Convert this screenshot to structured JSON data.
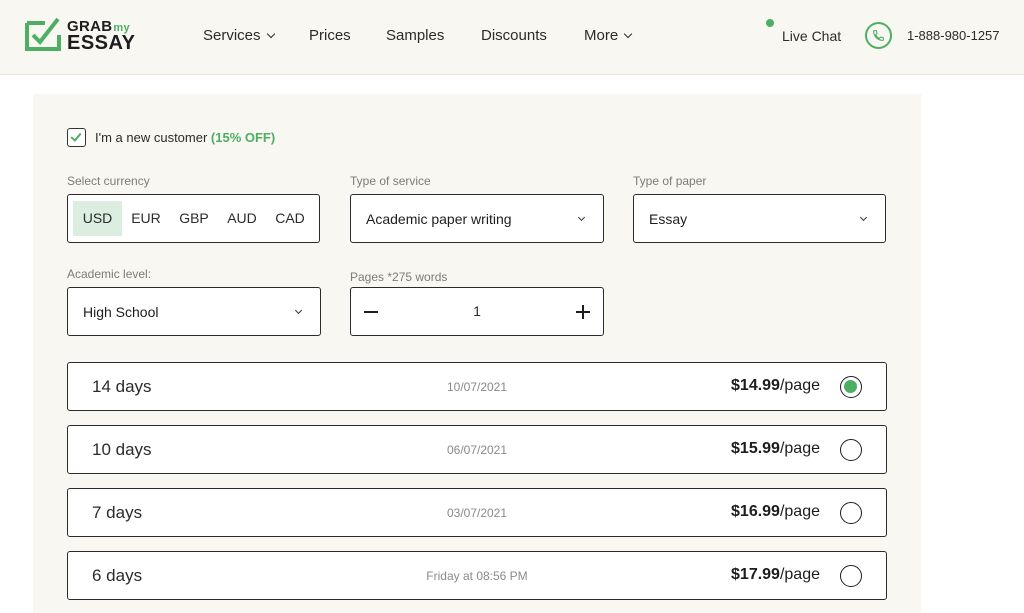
{
  "header": {
    "logo": {
      "line1": "GRAB",
      "line1_suffix": "my",
      "line2": "ESSAY"
    },
    "nav": [
      {
        "label": "Services",
        "has_dropdown": true
      },
      {
        "label": "Prices",
        "has_dropdown": false
      },
      {
        "label": "Samples",
        "has_dropdown": false
      },
      {
        "label": "Discounts",
        "has_dropdown": false
      },
      {
        "label": "More",
        "has_dropdown": true
      }
    ],
    "live_chat": "Live Chat",
    "phone": "1-888-980-1257"
  },
  "form": {
    "new_customer": {
      "label": "I'm a new customer",
      "discount": "(15% OFF)",
      "checked": true
    },
    "currency": {
      "label": "Select currency",
      "options": [
        "USD",
        "EUR",
        "GBP",
        "AUD",
        "CAD"
      ],
      "selected": "USD"
    },
    "service_type": {
      "label": "Type of service",
      "value": "Academic paper writing"
    },
    "paper_type": {
      "label": "Type of paper",
      "value": "Essay"
    },
    "academic_level": {
      "label": "Academic level:",
      "value": "High School"
    },
    "pages": {
      "label": "Pages *275 words",
      "value": "1"
    },
    "deadlines": [
      {
        "days": "14 days",
        "date": "10/07/2021",
        "price": "$14.99",
        "unit": "/page",
        "selected": true
      },
      {
        "days": "10 days",
        "date": "06/07/2021",
        "price": "$15.99",
        "unit": "/page",
        "selected": false
      },
      {
        "days": "7 days",
        "date": "03/07/2021",
        "price": "$16.99",
        "unit": "/page",
        "selected": false
      },
      {
        "days": "6 days",
        "date": "Friday at 08:56 PM",
        "price": "$17.99",
        "unit": "/page",
        "selected": false
      }
    ]
  },
  "colors": {
    "accent": "#4caf63",
    "panel_bg": "#f8f7f2",
    "active_currency_bg": "#dbeee0"
  },
  "icons": {
    "phone": "phone-icon",
    "check": "check-icon",
    "chevron": "chevron-down-icon"
  }
}
